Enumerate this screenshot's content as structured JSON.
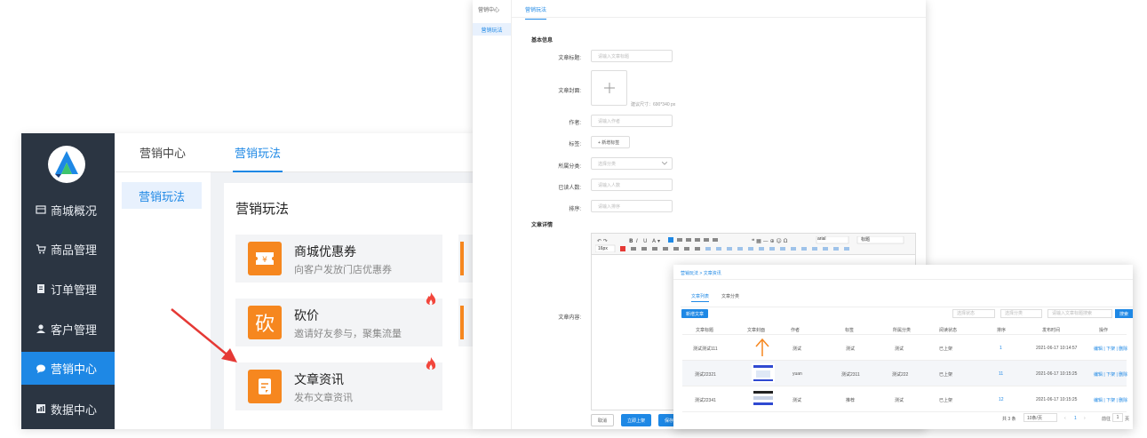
{
  "admin": {
    "sidebar": {
      "items": [
        {
          "label": "商城概况",
          "icon": "store-icon"
        },
        {
          "label": "商品管理",
          "icon": "cart-icon"
        },
        {
          "label": "订单管理",
          "icon": "clipboard-icon"
        },
        {
          "label": "客户管理",
          "icon": "user-icon"
        },
        {
          "label": "营销中心",
          "icon": "chat-icon",
          "active": true
        },
        {
          "label": "数据中心",
          "icon": "chart-icon"
        }
      ]
    },
    "subnav": {
      "title": "营销中心",
      "item": "营销玩法"
    },
    "tab": "营销玩法",
    "content_title": "营销玩法",
    "cards": [
      {
        "title": "商城优惠券",
        "subtitle": "向客户发放门店优惠券",
        "icon": "coupon-icon",
        "hot": false
      },
      {
        "title": "砍价",
        "subtitle": "邀请好友参与，聚集流量",
        "icon": "bargain-icon",
        "icon_text": "砍",
        "hot": true
      },
      {
        "title": "文章资讯",
        "subtitle": "发布文章资讯",
        "icon": "article-icon",
        "hot": true
      }
    ],
    "accent": "#1e88e5",
    "brand_orange": "#f6871f"
  },
  "editor": {
    "breadcrumb": "营销中心",
    "tab": "营销玩法",
    "side_item": "营销玩法",
    "section_basic": "基本信息",
    "fields": {
      "title_label": "文章标题:",
      "title_placeholder": "请输入文章标题",
      "cover_label": "文章封面:",
      "cover_hint": "建议尺寸：690*340 px",
      "author_label": "作者:",
      "author_placeholder": "请输入作者",
      "tag_label": "标签:",
      "tag_button": "+ 新增标签",
      "category_label": "所属分类:",
      "category_placeholder": "选择分类",
      "readers_label": "已读人数:",
      "readers_placeholder": "请输入人数",
      "sort_label": "排序:",
      "sort_placeholder": "请输入排序"
    },
    "section_detail": "文章详情",
    "content_label": "文章内容:",
    "toolbar": {
      "font": "arial",
      "size": "16px",
      "heading": "标题"
    },
    "buttons": {
      "cancel": "取消",
      "publish": "立即上架",
      "save": "保存"
    }
  },
  "list": {
    "breadcrumb": "营销玩法 > 文章资讯",
    "tabs": [
      "文章列表",
      "文章分类"
    ],
    "add_button": "新增文章",
    "filters": {
      "status": "选择状态",
      "category": "选择分类",
      "keyword": "请输入文章标题搜索",
      "search": "搜索"
    },
    "columns": [
      "文章标题",
      "文章封面",
      "作者",
      "标签",
      "所属分类",
      "阅读状态",
      "排序",
      "发布时间",
      "操作"
    ],
    "rows": [
      {
        "title": "测试测试111",
        "author": "测试",
        "tag": "测试",
        "category": "测试",
        "status": "已上架",
        "sort": "1",
        "time": "2021-06-17 10:14:57",
        "actions": "编辑 | 下架 | 删除"
      },
      {
        "title": "测试22321",
        "author": "yuan",
        "tag": "测试2311",
        "category": "测试222",
        "status": "已上架",
        "sort": "11",
        "time": "2021-06-17 10:15:25",
        "actions": "编辑 | 下架 | 删除"
      },
      {
        "title": "测试22341",
        "author": "测试",
        "tag": "推荐",
        "category": "测试",
        "status": "已上架",
        "sort": "12",
        "time": "2021-06-17 10:15:25",
        "actions": "编辑 | 下架 | 删除"
      }
    ],
    "pagination": {
      "total": "共 3 条",
      "size": "10条/页",
      "page": "1",
      "goto": "前往",
      "goto_page": "1",
      "page_unit": "页"
    }
  }
}
